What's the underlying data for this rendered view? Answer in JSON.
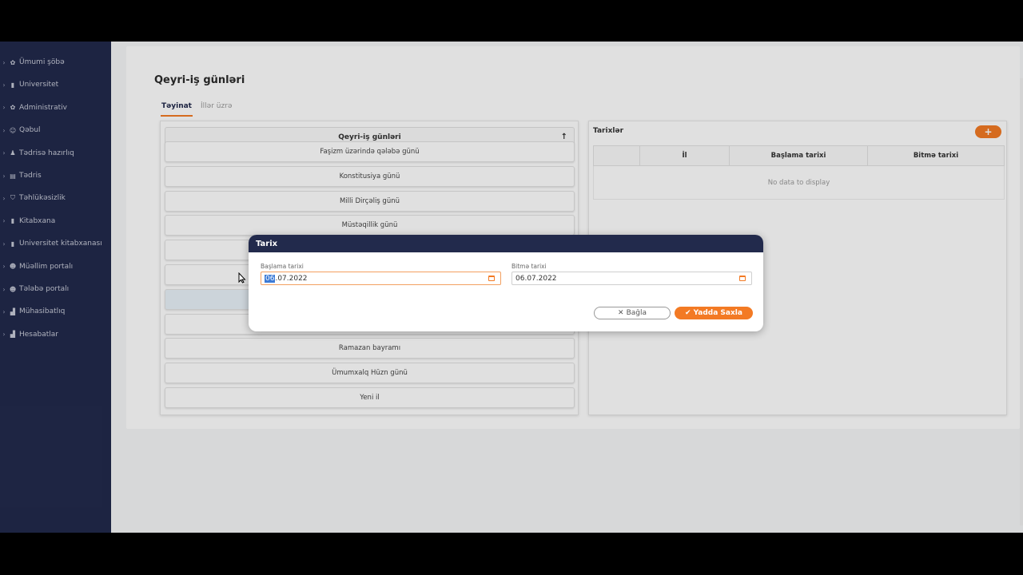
{
  "sidebar": {
    "items": [
      {
        "icon": "gear-icon",
        "glyph": "✿",
        "label": "Ümumi şöbə"
      },
      {
        "icon": "book-icon",
        "glyph": "▮",
        "label": "Universitet"
      },
      {
        "icon": "gear-icon",
        "glyph": "✿",
        "label": "Administrativ"
      },
      {
        "icon": "user-plus-icon",
        "glyph": "☺",
        "label": "Qəbul"
      },
      {
        "icon": "people-icon",
        "glyph": "♟",
        "label": "Tədrisə hazırlıq"
      },
      {
        "icon": "file-icon",
        "glyph": "▤",
        "label": "Tədris"
      },
      {
        "icon": "shield-icon",
        "glyph": "⛉",
        "label": "Təhlükəsizlik"
      },
      {
        "icon": "book-icon",
        "glyph": "▮",
        "label": "Kitabxana"
      },
      {
        "icon": "book-icon",
        "glyph": "▮",
        "label": "Universitet kitabxanası"
      },
      {
        "icon": "user-icon",
        "glyph": "☻",
        "label": "Müəllim portalı"
      },
      {
        "icon": "user-icon",
        "glyph": "☻",
        "label": "Tələbə portalı"
      },
      {
        "icon": "chart-icon",
        "glyph": "▟",
        "label": "Mühasibatlıq"
      },
      {
        "icon": "chart-icon",
        "glyph": "▟",
        "label": "Hesabatlar"
      }
    ]
  },
  "page": {
    "title": "Qeyri-iş günləri",
    "tabs": [
      "Təyinat",
      "İllər üzrə"
    ]
  },
  "holidays": {
    "header": "Qeyri-iş günləri",
    "sort_glyph": "↑",
    "items": [
      "Faşizm üzərində qələbə günü",
      "Konstitusiya günü",
      "Milli Dirçəliş günü",
      "Müstəqillik günü",
      "",
      "",
      "",
      "",
      "Ramazan bayramı",
      "Ümumxalq Hüzn günü",
      "Yeni il"
    ]
  },
  "dates_panel": {
    "title": "Tarixlər",
    "add_glyph": "+",
    "columns": [
      "",
      "İl",
      "Başlama tarixi",
      "Bitmə tarixi"
    ],
    "empty_text": "No data to display"
  },
  "modal": {
    "title": "Tarix",
    "start_label": "Başlama tarixi",
    "start_selected": "06",
    "start_rest": ".07.2022",
    "end_label": "Bitmə tarixi",
    "end_value": "06.07.2022",
    "close_icon": "✕",
    "close_label": "Bağla",
    "save_icon": "✔",
    "save_label": "Yadda Saxla"
  },
  "colors": {
    "sidebar": "#222a4c",
    "accent": "#f37a24"
  }
}
